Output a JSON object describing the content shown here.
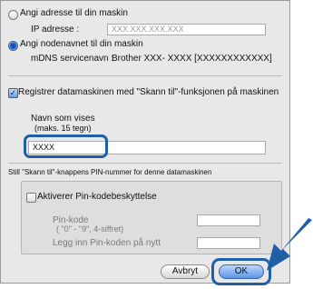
{
  "option_address": {
    "label": "Angi adresse til din maskin",
    "selected": false
  },
  "ip_address": {
    "label": "IP adresse :",
    "placeholder": "XXX.XXX.XXX.XXX"
  },
  "option_nodename": {
    "label": "Angi nodenavnet til din maskin",
    "selected": true
  },
  "mdns": {
    "label": "mDNS servicenavn :",
    "value": "Brother  XXX- XXXX  [XXXXXXXXXXXX]"
  },
  "register": {
    "label": "Registrer datamaskinen med \"Skann til\"-funksjonen på maskinen",
    "checked": true,
    "check_glyph": "✓"
  },
  "display_name": {
    "label_line1": "Navn som vises",
    "label_line2": "(maks. 15 tegn)",
    "value": "XXXX"
  },
  "pin_section_title": "Still \"Skann til\"-knappens PIN-nummer for denne datamaskinen",
  "pin_protection": {
    "label": "Aktiverer Pin-kodebeskyttelse",
    "checked": false
  },
  "pin_code": {
    "label_line1": "Pin-kode",
    "label_line2": "( \"0\" - \"9\", 4-siffret)"
  },
  "pin_confirm": {
    "label": "Legg inn Pin-koden på nytt"
  },
  "buttons": {
    "cancel": "Avbryt",
    "ok": "OK"
  },
  "colors": {
    "callout": "#1f5fa8",
    "default_button": "#5d95e8"
  },
  "icons": {
    "pointer": "arrow-pointer-icon"
  }
}
